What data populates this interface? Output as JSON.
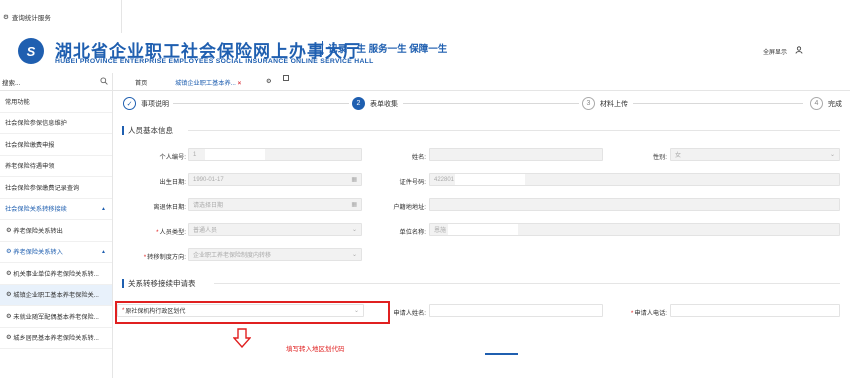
{
  "topstrip": {
    "label": "查询统计服务"
  },
  "header": {
    "logo_text": "S",
    "title": "湖北省企业职工社会保险网上办事大厅",
    "slogan": "记录一生 服务一生 保障一生",
    "en_title": "HUBEI PROVINCE ENTERPRISE EMPLOYEES SOCIAL INSURANCE ONLINE SERVICE HALL",
    "fullscreen": "全屏显示",
    "user_icon": "user-icon"
  },
  "sidebar": {
    "search_placeholder": "搜索...",
    "items": [
      {
        "label": "常用功能"
      },
      {
        "label": "社会保险参保信息维护"
      },
      {
        "label": "社会保险缴费申报"
      },
      {
        "label": "养老保险待遇申领"
      },
      {
        "label": "社会保险参保缴费记录查询"
      },
      {
        "label": "社会保险关系转移接续",
        "caret": "▲"
      },
      {
        "label": "养老保险关系转出"
      },
      {
        "label": "养老保险关系转入",
        "caret": "▲"
      },
      {
        "label": "机关事业单位养老保险关系转..."
      },
      {
        "label": "城镇企业职工基本养老保险关..."
      },
      {
        "label": "未就业随军配偶基本养老保险..."
      },
      {
        "label": "城乡居民基本养老保险关系转..."
      }
    ]
  },
  "tabs": {
    "home": "首页",
    "active": "城镇企业职工基本养...",
    "close": "×"
  },
  "steps": [
    {
      "num": "✓",
      "label": "事项说明"
    },
    {
      "num": "2",
      "label": "表单收集"
    },
    {
      "num": "3",
      "label": "材料上传"
    },
    {
      "num": "4",
      "label": "完成"
    }
  ],
  "section1": {
    "title": "人员基本信息",
    "fields": {
      "personal_id_label": "个人编号:",
      "personal_id_value": "1",
      "name_label": "姓名:",
      "gender_label": "性别:",
      "gender_value": "女",
      "birth_label": "出生日期:",
      "birth_value": "1990-01-17",
      "idtype_label": "证件号码:",
      "idtype_value": "422801",
      "retire_label": "离退休日期:",
      "retire_placeholder": "请选择日期",
      "hukou_label": "户籍地地址:",
      "ptype_label": "人员类型:",
      "ptype_value": "普通人员",
      "unit_label": "单位名称:",
      "unit_value": "恩施",
      "system_label": "转移制度方向:",
      "system_value": "企业职工养老保险制度内转移"
    }
  },
  "section2": {
    "title": "关系转移接续申请表",
    "fields": {
      "orig_label": "原社保机构行政区划代",
      "applicant_label": "申请人姓名:",
      "phone_label": "申请人电话:"
    }
  },
  "annotation": {
    "note": "填写转入地区划代码"
  },
  "colors": {
    "brand": "#1f5fb0",
    "alert": "#e02020"
  }
}
